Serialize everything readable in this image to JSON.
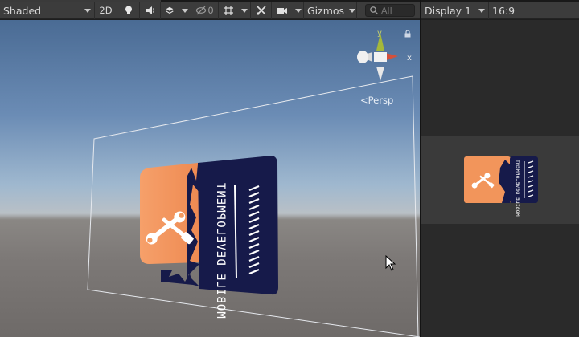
{
  "scene_toolbar": {
    "shading_mode": "Shaded",
    "mode_2d": "2D",
    "hidden_count": "0",
    "gizmos": "Gizmos",
    "search_placeholder": "All"
  },
  "game_toolbar": {
    "display": "Display 1",
    "aspect": "16:9"
  },
  "scene_gizmo": {
    "x_label": "x",
    "y_label": "y",
    "projection": "Persp"
  },
  "card": {
    "title_text": "MOBILE DEVELOPMENT",
    "left_color": "#f2935a",
    "right_color": "#161a4a"
  },
  "colors": {
    "toolbar_bg": "#3c3c3c",
    "sky_top": "#4a6b94",
    "ground": "#7d7977"
  }
}
